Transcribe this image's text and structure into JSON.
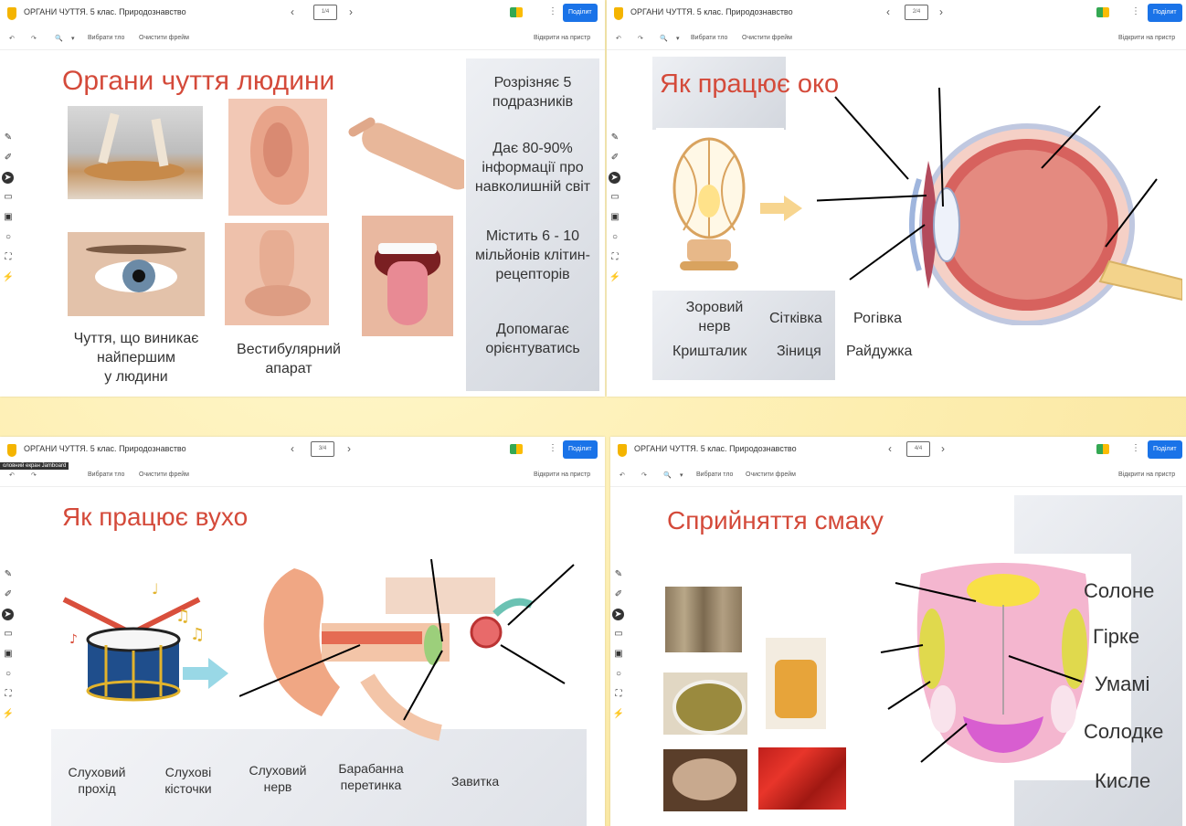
{
  "app": {
    "doc_title": "ОРГАНИ ЧУТТЯ. 5 клас. Природознавство",
    "toolbar": {
      "undo": "↶",
      "redo": "↷",
      "zoom": "🔍",
      "zoom_caret": "▾",
      "set_background": "Вибрати тло",
      "clear_frame": "Очистити фрейм",
      "open_on_device": "Відкрити на пристр"
    },
    "nav": {
      "prev": "‹",
      "next": "›"
    },
    "share_label": "Поділит",
    "kebab": "⋮",
    "tooltip": "оловний екран Jamboard",
    "side_tools": [
      "✎",
      "✐",
      "➤",
      "▭",
      "▣",
      "○",
      "⛶",
      "⚡"
    ]
  },
  "panels": [
    {
      "frame": "1/4",
      "title": "Органи чуття людини",
      "right_facts": [
        "Розрізняє 5\nподразників",
        "Дає 80-90%\nінформації про\nнавколишній світ",
        "Містить 6 - 10\nмільйонів клітин-\nрецепторів",
        "Допомагає\nорієнтуватись"
      ],
      "labels": {
        "first_sense": "Чуття, що виникає\nнайпершим\nу людини",
        "vestibular": "Вестибулярний\nапарат"
      }
    },
    {
      "frame": "2/4",
      "title": "Як працює око",
      "labels": [
        "Зоровий\nнерв",
        "Сітківка",
        "Рогівка",
        "Кришталик",
        "Зіниця",
        "Райдужка"
      ]
    },
    {
      "frame": "3/4",
      "title": "Як працює вухо",
      "labels": [
        "Слуховий\nпрохід",
        "Слухові\nкісточки",
        "Слуховий\nнерв",
        "Барабанна\nперетинка",
        "Завитка"
      ]
    },
    {
      "frame": "4/4",
      "title": "Сприйняття смаку",
      "labels": [
        "Солоне",
        "Гірке",
        "Умамі",
        "Солодке",
        "Кисле"
      ]
    }
  ],
  "colors": {
    "title_red": "#d44a3a",
    "share_blue": "#1a73e8",
    "background": "#fdeeb0"
  }
}
